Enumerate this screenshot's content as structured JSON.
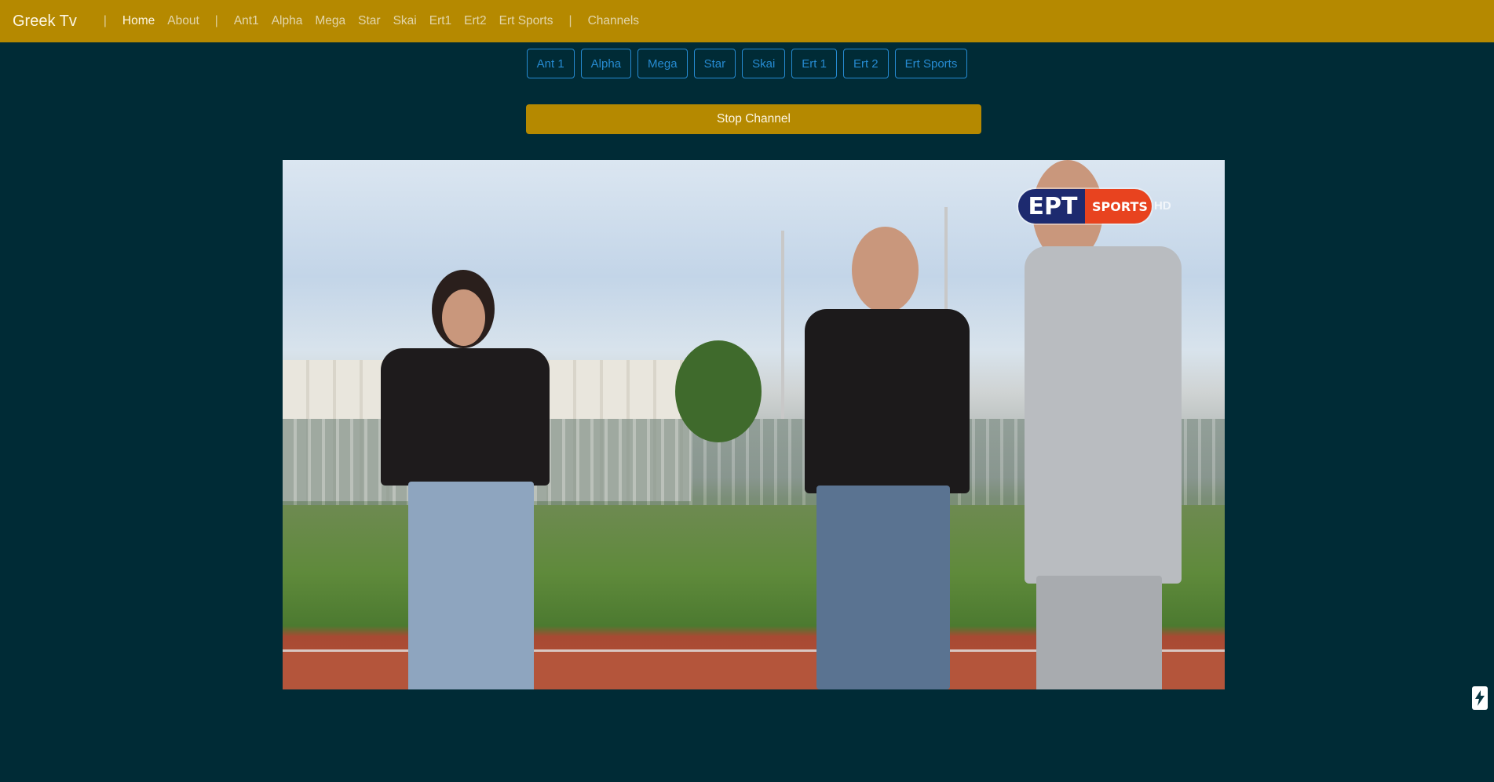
{
  "navbar": {
    "brand": "Greek Tv",
    "separator": "|",
    "primary_links": [
      {
        "label": "Home",
        "active": true
      },
      {
        "label": "About",
        "active": false
      }
    ],
    "channel_links": [
      "Ant1",
      "Alpha",
      "Mega",
      "Star",
      "Skai",
      "Ert1",
      "Ert2",
      "Ert Sports"
    ],
    "channels_link": "Channels"
  },
  "channel_buttons": [
    "Ant 1",
    "Alpha",
    "Mega",
    "Star",
    "Skai",
    "Ert 1",
    "Ert 2",
    "Ert Sports"
  ],
  "stop_button": "Stop Channel",
  "player": {
    "logo_main": "ΕΡΤ",
    "logo_sub": "SPORTS",
    "logo_hd": "HD"
  },
  "float_button_icon": "lightning-icon",
  "colors": {
    "background": "#002b36",
    "navbar": "#b58900",
    "accent": "#268bd2"
  }
}
